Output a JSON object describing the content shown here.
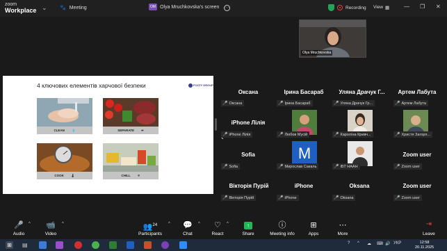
{
  "titlebar": {
    "logo_top": "zoom",
    "logo_bottom": "Workplace",
    "meeting_label": "Meeting",
    "screen_badge": "OM",
    "screen_title": "Olya Mruchkovska's screen",
    "recording_label": "Recording",
    "view_label": "View"
  },
  "slide": {
    "title": "4 ключових елементів харчової безпеки",
    "logo": "FOZZY GROUP",
    "cards": [
      {
        "label": "CLEAN",
        "icon": "💧"
      },
      {
        "label": "SEPARATE",
        "icon": "⇹"
      },
      {
        "label": "COOK",
        "icon": "🌡"
      },
      {
        "label": "CHILL",
        "icon": "❄"
      }
    ]
  },
  "self_view": {
    "name": "Olya Mruchkovska"
  },
  "participants": [
    {
      "name": "Оксана",
      "tag": "Оксана"
    },
    {
      "name": "Ірина Басараб",
      "tag": "Ірина Басараб"
    },
    {
      "name": "Уляна Драчук Г...",
      "tag": "Уляна Драчук Гр..."
    },
    {
      "name": "Артем Лабута",
      "tag": "Артем Лабута"
    },
    {
      "name": "iPhone Лілія",
      "tag": "iPhone Лілія"
    },
    {
      "name": "",
      "tag": "Любов Мусій"
    },
    {
      "name": "",
      "tag": "Каролїна Кривч..."
    },
    {
      "name": "",
      "tag": "Христя Загорп..."
    },
    {
      "name": "Sofia",
      "tag": "Sofia"
    },
    {
      "name": "",
      "tag": "Мирослав Сакаль",
      "avatar_letter": "M"
    },
    {
      "name": "",
      "tag": "ІБТ НААН"
    },
    {
      "name": "Zoom user",
      "tag": "Zoom user"
    },
    {
      "name": "Вікторія Пурій",
      "tag": "Вікторія Пурій"
    },
    {
      "name": "iPhone",
      "tag": "iPhone"
    },
    {
      "name": "Oksana",
      "tag": "Oksana"
    },
    {
      "name": "Zoom user",
      "tag": "Zoom user"
    }
  ],
  "toolbar": {
    "audio": "Audio",
    "video": "Video",
    "participants": "Participants",
    "participants_count": "24",
    "chat": "Chat",
    "react": "React",
    "share": "Share",
    "meeting_info": "Meeting info",
    "apps": "Apps",
    "more": "More",
    "leave": "Leave"
  },
  "taskbar": {
    "language": "УКР",
    "time": "12:58",
    "date": "20.11.2025"
  },
  "colors": {
    "accent_green": "#23a559",
    "share_green": "#1db954",
    "recording_red": "#e0443b",
    "avatar_blue": "#1e5fbf"
  }
}
